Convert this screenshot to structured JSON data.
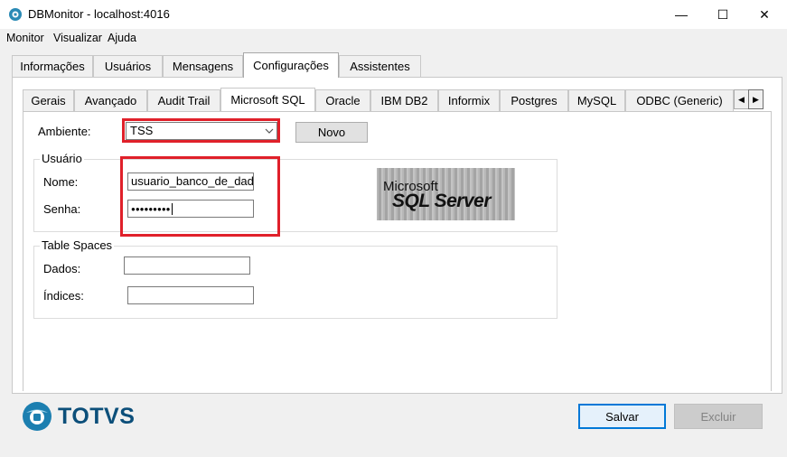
{
  "window": {
    "title": "DBMonitor - localhost:4016",
    "minimize": "—",
    "maximize": "☐",
    "close": "✕"
  },
  "menu": {
    "items": [
      "Monitor",
      "Visualizar",
      "Ajuda"
    ]
  },
  "main_tabs": [
    "Informações",
    "Usuários",
    "Mensagens",
    "Configurações",
    "Assistentes"
  ],
  "db_tabs": [
    "Gerais",
    "Avançado",
    "Audit Trail",
    "Microsoft SQL",
    "Oracle",
    "IBM DB2",
    "Informix",
    "Postgres",
    "MySQL",
    "ODBC (Generic)"
  ],
  "tab_scroll": {
    "left": "◀",
    "right": "▶"
  },
  "form": {
    "ambiente_label": "Ambiente:",
    "ambiente_value": "TSS",
    "novo_button": "Novo",
    "usuario_group": "Usuário",
    "nome_label": "Nome:",
    "nome_value": "usuario_banco_de_dados",
    "senha_label": "Senha:",
    "senha_value": "●●●●●●●●●",
    "tablespaces_group": "Table Spaces",
    "dados_label": "Dados:",
    "dados_value": "",
    "indices_label": "Índices:",
    "indices_value": ""
  },
  "logo": {
    "line1": "Microsoft",
    "line2": "SQL Server"
  },
  "brand": {
    "name": "TOTVS",
    "color": "#0c4f7a"
  },
  "buttons": {
    "salvar": "Salvar",
    "excluir": "Excluir"
  },
  "colors": {
    "highlight": "#e0202a",
    "accent": "#0078d7"
  }
}
